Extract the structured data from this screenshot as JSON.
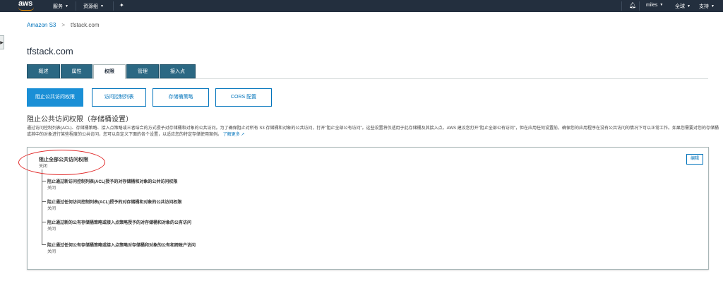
{
  "topnav": {
    "logo": "aws",
    "services": "服务",
    "resource_groups": "资源组",
    "user": "miles",
    "region": "全球",
    "support": "支持",
    "icons": [
      "pin-icon",
      "bell-icon"
    ]
  },
  "breadcrumb": {
    "root": "Amazon S3",
    "separator": ">",
    "current": "tfstack.com"
  },
  "page_title": "tfstack.com",
  "tabs": [
    {
      "label": "概述"
    },
    {
      "label": "属性"
    },
    {
      "label": "权限"
    },
    {
      "label": "管理"
    },
    {
      "label": "接入点"
    }
  ],
  "subtabs": [
    {
      "label": "阻止公共访问权限"
    },
    {
      "label": "访问控制列表"
    },
    {
      "label": "存储桶策略"
    },
    {
      "label": "CORS 配置"
    }
  ],
  "section": {
    "title": "阻止公共访问权限（存储桶设置）",
    "description": "通过访问控制列表(ACL)、存储桶策略、接入点策略或三者结合的方式授予对存储桶和对象的公共访问。为了确保阻止对所有 S3 存储桶和对象的公共访问，打开\"阻止全部公有访问\"。这些设置将仅适用于此存储桶及其接入点。AWS 建议您打开\"阻止全部公有访问\"，但在应用任何设置前，确保您的应用程序在没有公共访问的情况下可以正常工作。如果您需要对您的存储桶或其中的对象进行某些程度的公共访问，您可以自定义下面的各个设置，以适应您的特定存储使用案例。",
    "learn_more": "了解更多"
  },
  "panel": {
    "title": "阻止全部公共访问权限",
    "status": "关闭",
    "edit": "编辑",
    "items": [
      {
        "title": "阻止通过新访问控制列表(ACL)授予的对存储桶和对象的公共访问权限",
        "status": "关闭"
      },
      {
        "title": "阻止通过任何访问控制列表(ACL)授予的对存储桶和对象的公共访问权限",
        "status": "关闭"
      },
      {
        "title": "阻止通过新的公有存储桶策略或接入点策略授予的对存储桶和对象的公有访问",
        "status": "关闭"
      },
      {
        "title": "阻止通过任何公有存储桶策略或接入点策略对存储桶和对象的公有和跨账户访问",
        "status": "关闭"
      }
    ]
  },
  "colors": {
    "nav_bg": "#232f3e",
    "tab_bg": "#2b6883",
    "accent": "#0073bb",
    "active_button": "#1a8fd6",
    "annotation": "#e02424"
  }
}
